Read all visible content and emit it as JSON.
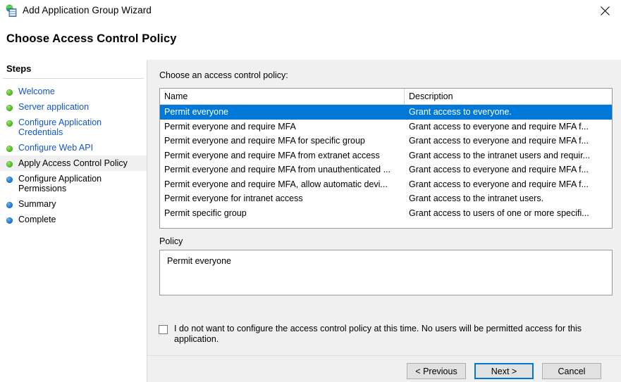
{
  "window": {
    "title": "Add Application Group Wizard",
    "icon": "application-group-icon",
    "close_label": "close-icon"
  },
  "header": {
    "title": "Choose Access Control Policy"
  },
  "sidebar": {
    "title": "Steps",
    "items": [
      {
        "label": "Welcome",
        "state": "done"
      },
      {
        "label": "Server application",
        "state": "done"
      },
      {
        "label": "Configure Application Credentials",
        "state": "done"
      },
      {
        "label": "Configure Web API",
        "state": "done"
      },
      {
        "label": "Apply Access Control Policy",
        "state": "current"
      },
      {
        "label": "Configure Application Permissions",
        "state": "pending"
      },
      {
        "label": "Summary",
        "state": "pending"
      },
      {
        "label": "Complete",
        "state": "pending"
      }
    ]
  },
  "main": {
    "choose_label": "Choose an access control policy:",
    "columns": {
      "name": "Name",
      "description": "Description"
    },
    "rows": [
      {
        "name": "Permit everyone",
        "description": "Grant access to everyone.",
        "selected": true
      },
      {
        "name": "Permit everyone and require MFA",
        "description": "Grant access to everyone and require MFA f...",
        "selected": false
      },
      {
        "name": "Permit everyone and require MFA for specific group",
        "description": "Grant access to everyone and require MFA f...",
        "selected": false
      },
      {
        "name": "Permit everyone and require MFA from extranet access",
        "description": "Grant access to the intranet users and requir...",
        "selected": false
      },
      {
        "name": "Permit everyone and require MFA from unauthenticated ...",
        "description": "Grant access to everyone and require MFA f...",
        "selected": false
      },
      {
        "name": "Permit everyone and require MFA, allow automatic devi...",
        "description": "Grant access to everyone and require MFA f...",
        "selected": false
      },
      {
        "name": "Permit everyone for intranet access",
        "description": "Grant access to the intranet users.",
        "selected": false
      },
      {
        "name": "Permit specific group",
        "description": "Grant access to users of one or more specifi...",
        "selected": false
      }
    ],
    "policy_label": "Policy",
    "policy_value": "Permit everyone",
    "optout_checkbox": {
      "checked": false,
      "label": "I do not want to configure the access control policy at this time.  No users will be permitted access for this application."
    }
  },
  "footer": {
    "previous_label": "< Previous",
    "next_label": "Next >",
    "cancel_label": "Cancel"
  },
  "colors": {
    "selection_blue": "#0078d7",
    "link_blue": "#1456c8",
    "panel_gray": "#f0f0f0",
    "step_done_green": "#5cc733",
    "step_pending_blue": "#2a84d8",
    "focus_border": "#0078d7"
  }
}
